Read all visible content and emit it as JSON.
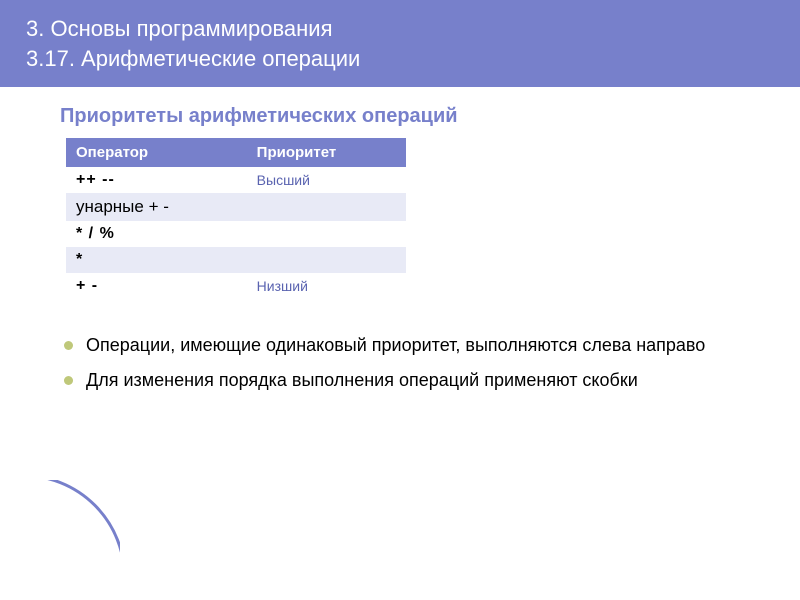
{
  "header": {
    "line1": "3. Основы программирования",
    "line2": "3.17. Арифметические операции"
  },
  "subtitle": "Приоритеты арифметических операций",
  "table": {
    "headers": {
      "operator": "Оператор",
      "priority": "Приоритет"
    },
    "rows": [
      {
        "op": "++     --",
        "pr": "Высший"
      },
      {
        "op": "унарные   + -",
        "pr": ""
      },
      {
        "op": "*    /   %",
        "pr": ""
      },
      {
        "op": "*",
        "pr": ""
      },
      {
        "op": "+    -",
        "pr": "Низший"
      }
    ]
  },
  "bullets": [
    "Операции, имеющие одинаковый приоритет, выполняются слева направо",
    "Для изменения порядка выполнения операций применяют скобки"
  ]
}
